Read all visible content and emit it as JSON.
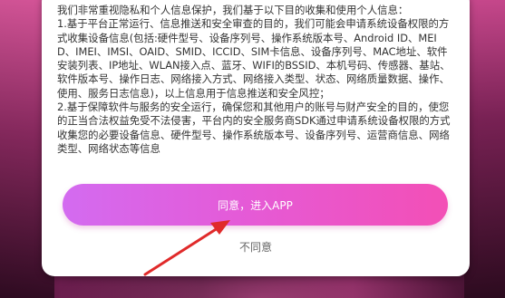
{
  "dialog": {
    "paragraphs": [
      "我们非常重视隐私和个人信息保护，我们基于以下目的收集和使用个人信息：",
      "1.基于平台正常运行、信息推送和安全审查的目的，我们可能会申请系统设备权限的方式收集设备信息(包括:硬件型号、设备序列号、操作系统版本号、Android ID、MEID、IMEI、IMSI、OAID、SMID、ICCID、SIM卡信息、设备序列号、MAC地址、软件安装列表、IP地址、WLAN接入点、蓝牙、WIFI的BSSID、本机号码、传感器、基站、软件版本号、操作日志、网络接入方式、网络接入类型、状态、网络质量数据、操作、使用、服务日志信息)，以上信息用于信息推送和安全风控；",
      "2.基于保障软件与服务的安全运行，确保您和其他用户的账号与财产安全的目的，使您的正当合法权益免受不法侵害，平台内的安全服务商SDK通过申请系统设备权限的方式收集您的必要设备信息、硬件型号、操作系统版本号、设备序列号、运营商信息、网络类型、网络状态等信息"
    ],
    "agree_label": "同意，进入APP",
    "disagree_label": "不同意"
  },
  "colors": {
    "button_gradient_start": "#d36bf0",
    "button_gradient_end": "#f34fb6",
    "annotation_arrow": "#e02a2a"
  },
  "annotation": {
    "type": "arrow",
    "points_to": "agree-button"
  }
}
